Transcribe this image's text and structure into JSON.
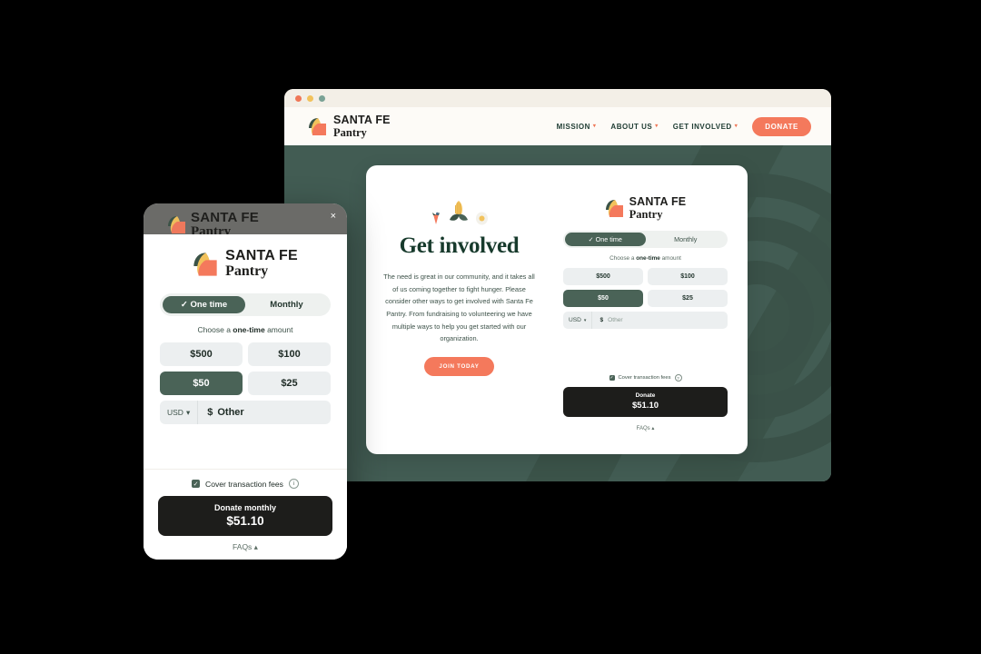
{
  "browser": {
    "dots": [
      "red",
      "yellow",
      "green"
    ]
  },
  "site": {
    "logo_line1": "SANTA FE",
    "logo_line2": "Pantry",
    "nav": [
      {
        "label": "MISSION",
        "caret": "chevron-down-icon"
      },
      {
        "label": "ABOUT US",
        "caret": "chevron-down-icon"
      },
      {
        "label": "GET INVOLVED",
        "caret": "chevron-down-icon"
      }
    ],
    "donate_button": "DONATE"
  },
  "desktop_card": {
    "decor_icons": [
      "strawberry-icon",
      "corn-icon",
      "egg-icon"
    ],
    "headline": "Get involved",
    "body": "The need is great in our community, and it takes all of us coming together to fight hunger. Please consider other ways to get involved with Santa Fe Pantry. From fundraising to volunteering we have multiple ways to help you get started with our organization.",
    "cta": "JOIN TODAY",
    "form": {
      "logo_line1": "SANTA FE",
      "logo_line2": "Pantry",
      "toggle": [
        {
          "label": "One time",
          "active": true,
          "check": "✓"
        },
        {
          "label": "Monthly",
          "active": false
        }
      ],
      "choose_prefix": "Choose a ",
      "choose_strong": "one-time",
      "choose_suffix": " amount",
      "amounts": [
        {
          "label": "$500",
          "selected": false
        },
        {
          "label": "$100",
          "selected": false
        },
        {
          "label": "$50",
          "selected": true
        },
        {
          "label": "$25",
          "selected": false
        }
      ],
      "currency": "USD",
      "currency_caret": "▾",
      "dollar_sign": "$",
      "other_placeholder": "Other",
      "fees_label": "Cover transaction fees",
      "fees_checked": true,
      "info_icon": "?",
      "donate_label": "Donate",
      "donate_amount": "$51.10",
      "faqs": "FAQs ▴"
    }
  },
  "mobile_modal": {
    "close_icon": "×",
    "scrim_logo_line1": "SANTA FE",
    "scrim_logo_line2": "Pantry",
    "logo_line1": "SANTA FE",
    "logo_line2": "Pantry",
    "toggle": [
      {
        "label": "One time",
        "active": true,
        "check": "✓"
      },
      {
        "label": "Monthly",
        "active": false
      }
    ],
    "choose_prefix": "Choose a ",
    "choose_strong": "one-time",
    "choose_suffix": " amount",
    "amounts": [
      {
        "label": "$500",
        "selected": false
      },
      {
        "label": "$100",
        "selected": false
      },
      {
        "label": "$50",
        "selected": true
      },
      {
        "label": "$25",
        "selected": false
      }
    ],
    "currency": "USD",
    "currency_caret": "▾",
    "dollar_sign": "$",
    "other_placeholder": "Other",
    "fees_label": "Cover transaction fees",
    "fees_checked": true,
    "info_icon": "i",
    "donate_label": "Donate monthly",
    "donate_amount": "$51.10",
    "faqs": "FAQs ▴"
  },
  "colors": {
    "brand_green": "#425c53",
    "button_green": "#4a6357",
    "coral": "#f4795c",
    "dark": "#1d1d1b",
    "cream": "#faf7f1",
    "light_grey": "#eceff0"
  }
}
